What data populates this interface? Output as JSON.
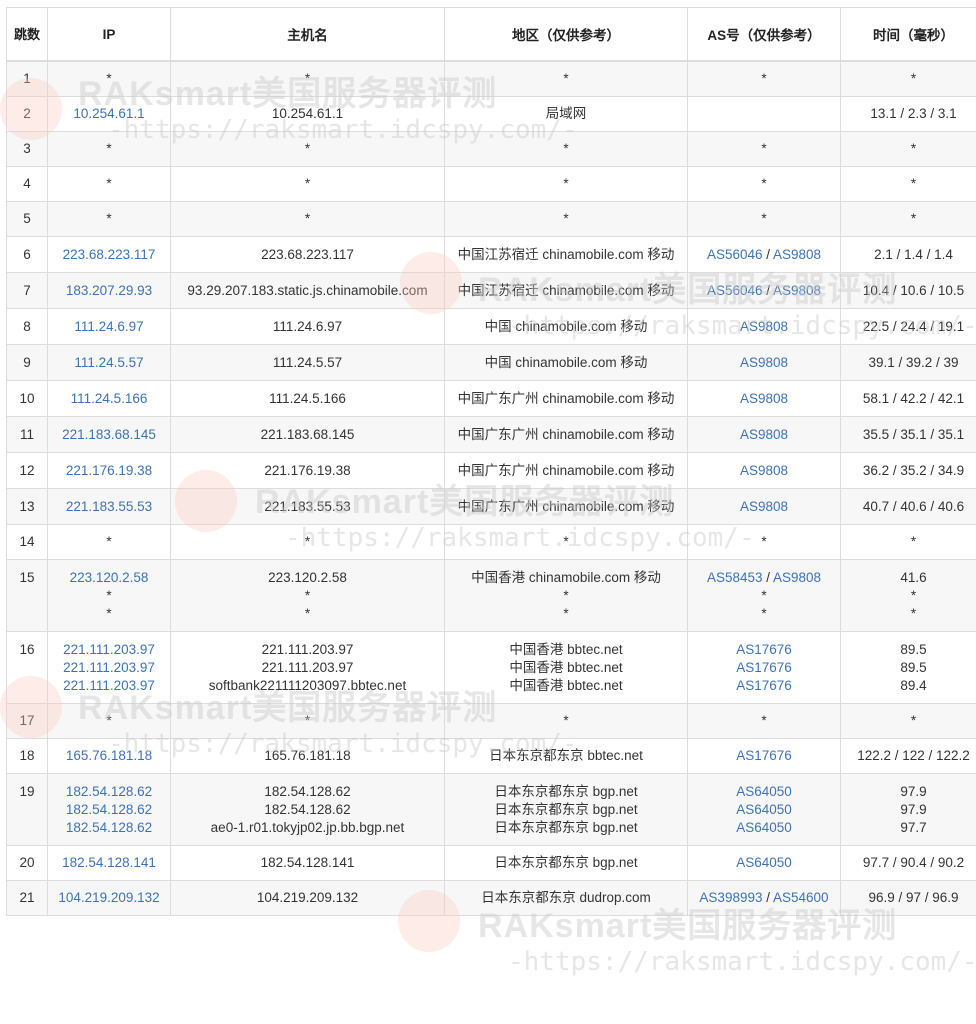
{
  "headers": [
    "跳数",
    "IP",
    "主机名",
    "地区（仅供参考）",
    "AS号（仅供参考）",
    "时间（毫秒）"
  ],
  "watermark": {
    "title": "RAKsmart美国服务器评测",
    "url": "-https://raksmart.idcspy.com/-"
  },
  "rows": [
    {
      "hop": "1",
      "ip": [
        "*"
      ],
      "host": [
        "*"
      ],
      "region": [
        "*"
      ],
      "as": [
        [
          "*"
        ]
      ],
      "time": [
        "*"
      ]
    },
    {
      "hop": "2",
      "ip": [
        "10.254.61.1"
      ],
      "host": [
        "10.254.61.1"
      ],
      "region": [
        "局域网"
      ],
      "as": [
        []
      ],
      "time": [
        "13.1 / 2.3 / 3.1"
      ]
    },
    {
      "hop": "3",
      "ip": [
        "*"
      ],
      "host": [
        "*"
      ],
      "region": [
        "*"
      ],
      "as": [
        [
          "*"
        ]
      ],
      "time": [
        "*"
      ]
    },
    {
      "hop": "4",
      "ip": [
        "*"
      ],
      "host": [
        "*"
      ],
      "region": [
        "*"
      ],
      "as": [
        [
          "*"
        ]
      ],
      "time": [
        "*"
      ]
    },
    {
      "hop": "5",
      "ip": [
        "*"
      ],
      "host": [
        "*"
      ],
      "region": [
        "*"
      ],
      "as": [
        [
          "*"
        ]
      ],
      "time": [
        "*"
      ]
    },
    {
      "hop": "6",
      "ip": [
        "223.68.223.117"
      ],
      "host": [
        "223.68.223.117"
      ],
      "region": [
        "中国江苏宿迁 chinamobile.com 移动"
      ],
      "as": [
        [
          "AS56046",
          "AS9808"
        ]
      ],
      "time": [
        "2.1 / 1.4 / 1.4"
      ]
    },
    {
      "hop": "7",
      "ip": [
        "183.207.29.93"
      ],
      "host": [
        "93.29.207.183.static.js.chinamobile.com"
      ],
      "region": [
        "中国江苏宿迁 chinamobile.com 移动"
      ],
      "as": [
        [
          "AS56046",
          "AS9808"
        ]
      ],
      "time": [
        "10.4 / 10.6 / 10.5"
      ]
    },
    {
      "hop": "8",
      "ip": [
        "111.24.6.97"
      ],
      "host": [
        "111.24.6.97"
      ],
      "region": [
        "中国 chinamobile.com 移动"
      ],
      "as": [
        [
          "AS9808"
        ]
      ],
      "time": [
        "22.5 / 24.4 / 19.1"
      ]
    },
    {
      "hop": "9",
      "ip": [
        "111.24.5.57"
      ],
      "host": [
        "111.24.5.57"
      ],
      "region": [
        "中国 chinamobile.com 移动"
      ],
      "as": [
        [
          "AS9808"
        ]
      ],
      "time": [
        "39.1 / 39.2 / 39"
      ]
    },
    {
      "hop": "10",
      "ip": [
        "111.24.5.166"
      ],
      "host": [
        "111.24.5.166"
      ],
      "region": [
        "中国广东广州 chinamobile.com 移动"
      ],
      "as": [
        [
          "AS9808"
        ]
      ],
      "time": [
        "58.1 / 42.2 / 42.1"
      ]
    },
    {
      "hop": "11",
      "ip": [
        "221.183.68.145"
      ],
      "host": [
        "221.183.68.145"
      ],
      "region": [
        "中国广东广州 chinamobile.com 移动"
      ],
      "as": [
        [
          "AS9808"
        ]
      ],
      "time": [
        "35.5 / 35.1 / 35.1"
      ]
    },
    {
      "hop": "12",
      "ip": [
        "221.176.19.38"
      ],
      "host": [
        "221.176.19.38"
      ],
      "region": [
        "中国广东广州 chinamobile.com 移动"
      ],
      "as": [
        [
          "AS9808"
        ]
      ],
      "time": [
        "36.2 / 35.2 / 34.9"
      ]
    },
    {
      "hop": "13",
      "ip": [
        "221.183.55.53"
      ],
      "host": [
        "221.183.55.53"
      ],
      "region": [
        "中国广东广州 chinamobile.com 移动"
      ],
      "as": [
        [
          "AS9808"
        ]
      ],
      "time": [
        "40.7 / 40.6 / 40.6"
      ]
    },
    {
      "hop": "14",
      "ip": [
        "*"
      ],
      "host": [
        "*"
      ],
      "region": [
        "*"
      ],
      "as": [
        [
          "*"
        ]
      ],
      "time": [
        "*"
      ]
    },
    {
      "hop": "15",
      "ip": [
        "223.120.2.58",
        "*",
        "*"
      ],
      "host": [
        "223.120.2.58",
        "*",
        "*"
      ],
      "region": [
        "中国香港 chinamobile.com 移动",
        "*",
        "*"
      ],
      "as": [
        [
          "AS58453",
          "AS9808"
        ],
        [
          "*"
        ],
        [
          "*"
        ]
      ],
      "time": [
        "41.6",
        "*",
        "*"
      ]
    },
    {
      "hop": "16",
      "ip": [
        "221.111.203.97",
        "221.111.203.97",
        "221.111.203.97"
      ],
      "host": [
        "221.111.203.97",
        "221.111.203.97",
        "softbank221111203097.bbtec.net"
      ],
      "region": [
        "中国香港 bbtec.net",
        "中国香港 bbtec.net",
        "中国香港 bbtec.net"
      ],
      "as": [
        [
          "AS17676"
        ],
        [
          "AS17676"
        ],
        [
          "AS17676"
        ]
      ],
      "time": [
        "89.5",
        "89.5",
        "89.4"
      ]
    },
    {
      "hop": "17",
      "ip": [
        "*"
      ],
      "host": [
        "*"
      ],
      "region": [
        "*"
      ],
      "as": [
        [
          "*"
        ]
      ],
      "time": [
        "*"
      ]
    },
    {
      "hop": "18",
      "ip": [
        "165.76.181.18"
      ],
      "host": [
        "165.76.181.18"
      ],
      "region": [
        "日本东京都东京 bbtec.net"
      ],
      "as": [
        [
          "AS17676"
        ]
      ],
      "time": [
        "122.2 / 122 / 122.2"
      ]
    },
    {
      "hop": "19",
      "ip": [
        "182.54.128.62",
        "182.54.128.62",
        "182.54.128.62"
      ],
      "host": [
        "182.54.128.62",
        "182.54.128.62",
        "ae0-1.r01.tokyjp02.jp.bb.bgp.net"
      ],
      "region": [
        "日本东京都东京 bgp.net",
        "日本东京都东京 bgp.net",
        "日本东京都东京 bgp.net"
      ],
      "as": [
        [
          "AS64050"
        ],
        [
          "AS64050"
        ],
        [
          "AS64050"
        ]
      ],
      "time": [
        "97.9",
        "97.9",
        "97.7"
      ]
    },
    {
      "hop": "20",
      "ip": [
        "182.54.128.141"
      ],
      "host": [
        "182.54.128.141"
      ],
      "region": [
        "日本东京都东京 bgp.net"
      ],
      "as": [
        [
          "AS64050"
        ]
      ],
      "time": [
        "97.7 / 90.4 / 90.2"
      ]
    },
    {
      "hop": "21",
      "ip": [
        "104.219.209.132"
      ],
      "host": [
        "104.219.209.132"
      ],
      "region": [
        "日本东京都东京 dudrop.com"
      ],
      "as": [
        [
          "AS398993",
          "AS54600"
        ]
      ],
      "time": [
        "96.9 / 97 / 96.9"
      ]
    }
  ]
}
